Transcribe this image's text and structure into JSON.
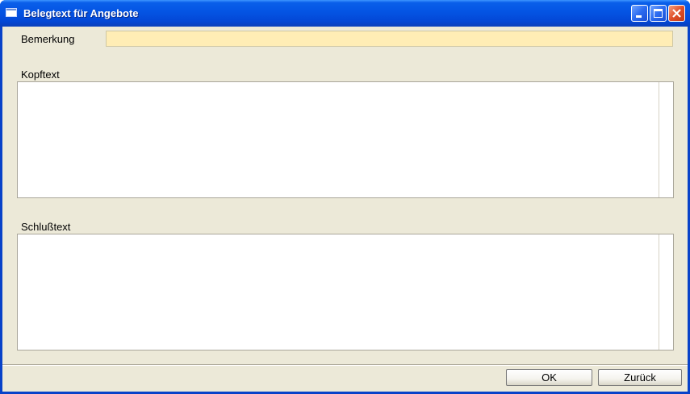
{
  "window": {
    "title": "Belegtext für Angebote",
    "controls": [
      "minimize-icon",
      "maximize-icon",
      "close-icon"
    ]
  },
  "form": {
    "bemerkung": {
      "label": "Bemerkung",
      "value": ""
    },
    "kopftext": {
      "label": "Kopftext",
      "value": ""
    },
    "schlusstext": {
      "label": "Schlußtext",
      "value": ""
    }
  },
  "buttons": {
    "ok": "OK",
    "back": "Zurück"
  },
  "colors": {
    "titlebar": "#0454E3",
    "window_bg": "#ECE9D8",
    "highlight_input": "#FFEDB5",
    "close_button": "#E0502A"
  }
}
